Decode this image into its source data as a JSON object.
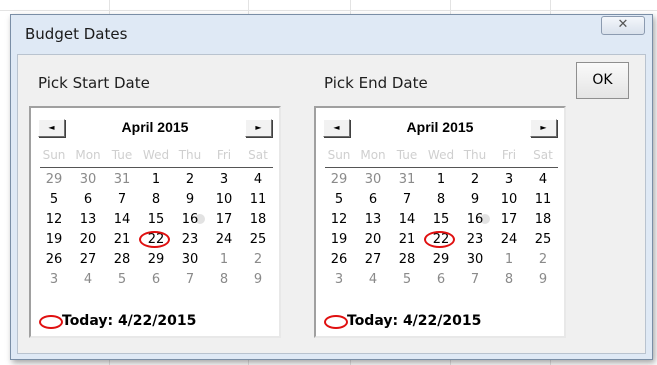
{
  "dialog": {
    "title": "Budget Dates",
    "close_icon": "close-icon",
    "ok_label": "OK"
  },
  "start": {
    "label": "Pick Start Date",
    "month": "April 2015",
    "prev_icon": "◄",
    "next_icon": "►",
    "today": "Today: 4/22/2015"
  },
  "end": {
    "label": "Pick End Date",
    "month": "April 2015",
    "prev_icon": "◄",
    "next_icon": "►",
    "today": "Today: 4/22/2015"
  },
  "weekdays": [
    "Sun",
    "Mon",
    "Tue",
    "Wed",
    "Thu",
    "Fri",
    "Sat"
  ],
  "weeks": [
    [
      "29",
      "30",
      "31",
      "1",
      "2",
      "3",
      "4"
    ],
    [
      "5",
      "6",
      "7",
      "8",
      "9",
      "10",
      "11"
    ],
    [
      "12",
      "13",
      "14",
      "15",
      "16",
      "17",
      "18"
    ],
    [
      "19",
      "20",
      "21",
      "22",
      "23",
      "24",
      "25"
    ],
    [
      "26",
      "27",
      "28",
      "29",
      "30",
      "1",
      "2"
    ],
    [
      "3",
      "4",
      "5",
      "6",
      "7",
      "8",
      "9"
    ]
  ],
  "colors": {
    "highlight": "#e01010",
    "other_month": "#8a8a8a"
  }
}
